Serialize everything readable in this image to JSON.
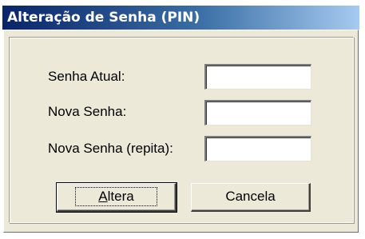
{
  "dialog": {
    "title": "Alteração de Senha (PIN)"
  },
  "form": {
    "current_password_label": "Senha Atual:",
    "new_password_label": "Nova Senha:",
    "repeat_password_label": "Nova Senha (repita):",
    "current_password_value": "",
    "new_password_value": "",
    "repeat_password_value": ""
  },
  "buttons": {
    "confirm_mnemonic": "A",
    "confirm_rest": "ltera",
    "cancel_label": "Cancela"
  }
}
